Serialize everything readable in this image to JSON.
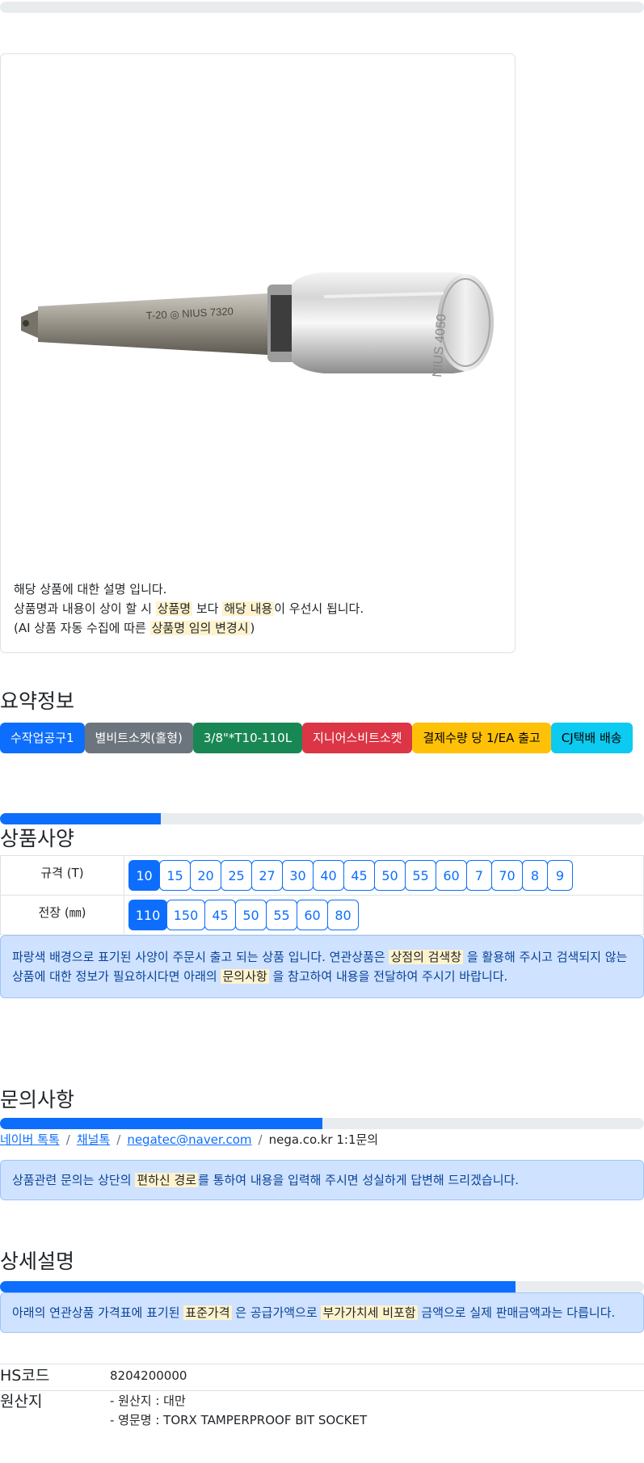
{
  "product": {
    "image_alt": "T-20 NIUS 7320 Torx tamperproof bit socket",
    "bit_text": "T-20 ◎ NIUS 7320",
    "socket_text": "NIUS 4050",
    "notice_line1": "해당 상품에 대한 설명 입니다.",
    "notice_line2_a": "상품명과 내용이 상이 할 시",
    "notice_line2_mark1": "상품명",
    "notice_line2_b": "보다",
    "notice_line2_mark2": "해당 내용",
    "notice_line2_c": "이 우선시 됩니다.",
    "notice_line3_a": "(AI 상품 자동 수집에 따른",
    "notice_line3_mark": "상품명 임의 변경시",
    "notice_line3_b": ")"
  },
  "summary": {
    "title": "요약정보",
    "badges": [
      {
        "label": "수작업공구1",
        "color": "#0d6efd"
      },
      {
        "label": "별비트소켓(홀형)",
        "color": "#6c757d"
      },
      {
        "label": "3/8\"*T10-110L",
        "color": "#198754"
      },
      {
        "label": "지니어스비트소켓",
        "color": "#dc3545"
      },
      {
        "label": "결제수량 당 1/EA 출고",
        "color": "#ffc107"
      },
      {
        "label": "CJ택배 배송",
        "color": "#0dcaf0"
      }
    ]
  },
  "spec": {
    "progress_percent": 25,
    "title": "상품사양",
    "rows": [
      {
        "label": "규격 (T)",
        "options": [
          "10",
          "15",
          "20",
          "25",
          "27",
          "30",
          "40",
          "45",
          "50",
          "55",
          "60",
          "7",
          "70",
          "8",
          "9"
        ],
        "selected": "10"
      },
      {
        "label": "전장 (㎜)",
        "options": [
          "110",
          "150",
          "45",
          "50",
          "55",
          "60",
          "80"
        ],
        "selected": "110"
      }
    ],
    "alert_a": "파랑색 배경으로 표기된 사양이 주문시 출고 되는 상품 입니다. 연관상품은",
    "alert_mark1": "상점의 검색창",
    "alert_b": "을 활용해 주시고 검색되지 않는 상품에 대한 정보가 필요하시다면 아래의",
    "alert_mark2": "문의사항",
    "alert_c": "을 참고하여 내용을 전달하여 주시기 바랍니다."
  },
  "inquiry": {
    "title": "문의사항",
    "progress_percent": 50,
    "links": [
      "네이버 톡톡",
      "채널톡",
      "negatec@naver.com"
    ],
    "plain": "nega.co.kr 1:1문의",
    "alert_a": "상품관련 문의는 상단의",
    "alert_mark": "편하신 경로",
    "alert_b": "를 통하여 내용을 입력해 주시면 성실하게 답변해 드리겠습니다."
  },
  "detail": {
    "title": "상세설명",
    "progress_percent": 80,
    "alert_a": "아래의 연관상품 가격표에 표기된",
    "alert_mark1": "표준가격",
    "alert_b": "은 공급가액으로",
    "alert_mark2": "부가가치세 비포함",
    "alert_c": "금액으로 실제 판매금액과는 다릅니다.",
    "hs_label": "HS코드",
    "hs_value": "8204200000",
    "origin_label": "원산지",
    "origin_line1": "- 원산지 : 대만",
    "origin_line2": "- 영문명 : TORX TAMPERPROOF BIT SOCKET"
  }
}
